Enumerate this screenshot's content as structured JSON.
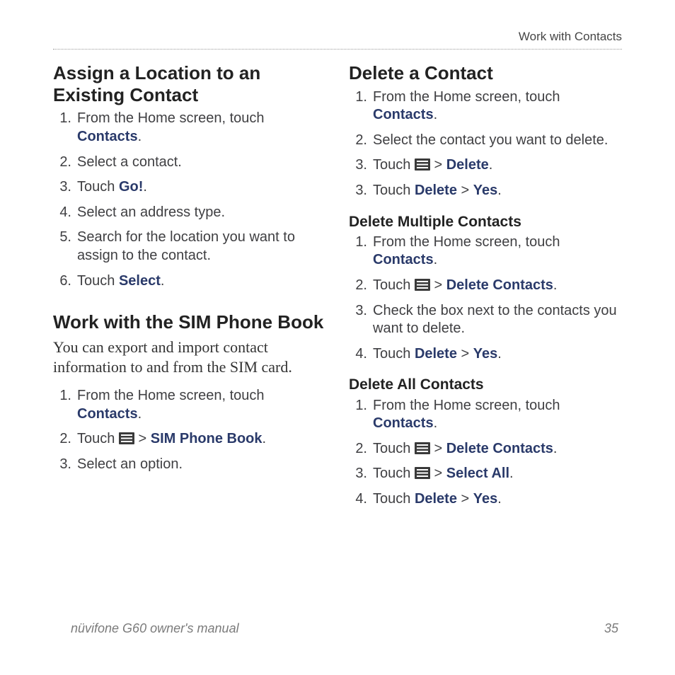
{
  "header": "Work with Contacts",
  "footer": {
    "left": "nüvifone G60 owner's manual",
    "right": "35"
  },
  "gt": ">",
  "period": ".",
  "left": {
    "sec1": {
      "title": "Assign a Location to an Existing Contact",
      "steps": [
        {
          "n": "1.",
          "pre": "From the Home screen, touch ",
          "b1": "Contacts",
          "post": "."
        },
        {
          "n": "2.",
          "pre": "Select a contact."
        },
        {
          "n": "3.",
          "pre": "Touch ",
          "b1": "Go!",
          "post": "."
        },
        {
          "n": "4.",
          "pre": "Select an address type."
        },
        {
          "n": "5.",
          "pre": "Search for the location you want to assign to the contact."
        },
        {
          "n": "6.",
          "pre": "Touch ",
          "b1": "Select",
          "post": "."
        }
      ]
    },
    "sec2": {
      "title": "Work with the SIM Phone Book",
      "body": "You can export and import contact information to and from the SIM card.",
      "steps": [
        {
          "n": "1.",
          "pre": "From the Home screen, touch ",
          "b1": "Contacts",
          "post": "."
        },
        {
          "n": "2.",
          "pre": "Touch ",
          "icon": true,
          "mid": " > ",
          "b1": "SIM Phone Book",
          "post": "."
        },
        {
          "n": "3.",
          "pre": "Select an option."
        }
      ]
    }
  },
  "right": {
    "sec1": {
      "title": "Delete a Contact",
      "steps": [
        {
          "n": "1.",
          "pre": "From the Home screen, touch ",
          "b1": "Contacts",
          "post": "."
        },
        {
          "n": "2.",
          "pre": "Select the contact you want to delete."
        },
        {
          "n": "3.",
          "pre": "Touch ",
          "icon": true,
          "mid": " > ",
          "b1": "Delete",
          "post": "."
        },
        {
          "n": "3.",
          "pre": "Touch ",
          "b1": "Delete",
          "mid": " > ",
          "b2": "Yes",
          "post": "."
        }
      ]
    },
    "sub1": {
      "title": "Delete Multiple Contacts",
      "steps": [
        {
          "n": "1.",
          "pre": "From the Home screen, touch ",
          "b1": "Contacts",
          "post": "."
        },
        {
          "n": "2.",
          "pre": "Touch ",
          "icon": true,
          "mid": " > ",
          "b1": "Delete Contacts",
          "post": "."
        },
        {
          "n": "3.",
          "pre": "Check the box next to the contacts you want to delete."
        },
        {
          "n": "4.",
          "pre": "Touch ",
          "b1": "Delete",
          "mid": " > ",
          "b2": "Yes",
          "post": "."
        }
      ]
    },
    "sub2": {
      "title": "Delete All Contacts",
      "steps": [
        {
          "n": "1.",
          "pre": "From the Home screen, touch ",
          "b1": "Contacts",
          "post": "."
        },
        {
          "n": "2.",
          "pre": "Touch ",
          "icon": true,
          "mid": " > ",
          "b1": "Delete Contacts",
          "post": "."
        },
        {
          "n": "3.",
          "pre": "Touch ",
          "icon": true,
          "mid": " > ",
          "b1": "Select All",
          "post": "."
        },
        {
          "n": "4.",
          "pre": "Touch ",
          "b1": "Delete",
          "mid": " > ",
          "b2": "Yes",
          "post": "."
        }
      ]
    }
  }
}
